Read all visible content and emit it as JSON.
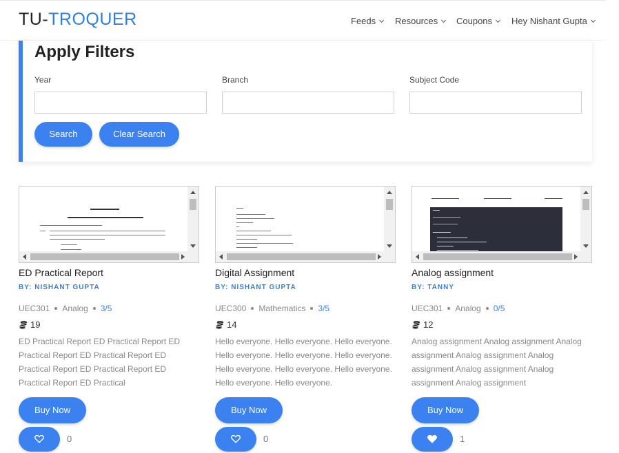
{
  "brand": {
    "part1": "TU-",
    "part2": "TROQUER"
  },
  "nav": {
    "items": [
      {
        "label": "Feeds"
      },
      {
        "label": "Resources"
      },
      {
        "label": "Coupons"
      },
      {
        "label": "Hey Nishant Gupta"
      }
    ]
  },
  "filters": {
    "title": "Apply Filters",
    "fields": [
      {
        "label": "Year",
        "value": "",
        "placeholder": ""
      },
      {
        "label": "Branch",
        "value": "",
        "placeholder": ""
      },
      {
        "label": "Subject Code",
        "value": "",
        "placeholder": ""
      }
    ],
    "search_label": "Search",
    "clear_label": "Clear Search"
  },
  "cards": [
    {
      "title": "ED Practical Report",
      "author": "BY: NISHANT GUPTA",
      "code": "UEC301",
      "subject": "Analog",
      "rating": "3/5",
      "coins": "19",
      "description": "ED Practical Report ED Practical Report ED Practical Report ED Practical Report ED Practical Report ED Practical Report ED Practical Report ED Practical",
      "buy_label": "Buy Now",
      "likes": "0",
      "liked": false,
      "preview_theme": "document"
    },
    {
      "title": "Digital Assignment",
      "author": "BY: NISHANT GUPTA",
      "code": "UEC300",
      "subject": "Mathematics",
      "rating": "3/5",
      "coins": "14",
      "description": "Hello everyone. Hello everyone. Hello everyone. Hello everyone. Hello everyone. Hello everyone. Hello everyone. Hello everyone. Hello everyone. Hello everyone. Hello everyone.",
      "buy_label": "Buy Now",
      "likes": "0",
      "liked": false,
      "preview_theme": "code-text"
    },
    {
      "title": "Analog assignment",
      "author": "BY: TANNY",
      "code": "UEC301",
      "subject": "Analog",
      "rating": "0/5",
      "coins": "12",
      "description": "Analog assignment Analog assignment Analog assignment Analog assignment Analog assignment Analog assignment Analog assignment Analog assignment",
      "buy_label": "Buy Now",
      "likes": "1",
      "liked": true,
      "preview_theme": "dark-code"
    }
  ],
  "colors": {
    "accent": "#3b82f0",
    "brand_blue": "#2f7fde",
    "author_blue": "#3b7fd0",
    "muted": "#888888"
  }
}
